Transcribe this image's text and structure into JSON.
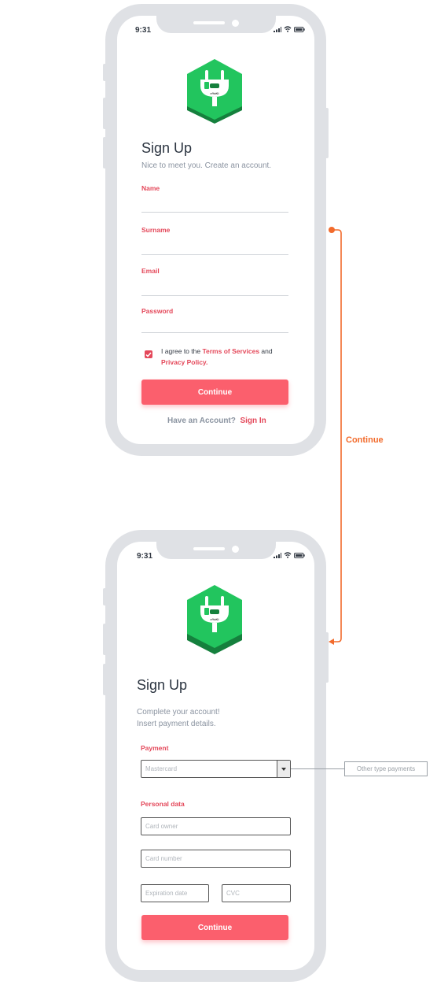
{
  "screen1": {
    "time": "9:31",
    "title": "Sign Up",
    "subtitle": "Nice to meet you. Create an account.",
    "fields": [
      {
        "label": "Name"
      },
      {
        "label": "Surname"
      },
      {
        "label": "Email"
      },
      {
        "label": "Password"
      }
    ],
    "agree_prefix": "I agree to the ",
    "terms_link": "Terms of Services",
    "agree_and": " and",
    "privacy_link": "Privacy Policy.",
    "continue_label": "Continue",
    "have_account": "Have an Account?",
    "sign_in": "Sign In"
  },
  "flow": {
    "label": "Continue",
    "color": "#f26b2c"
  },
  "screen2": {
    "time": "9:31",
    "title": "Sign Up",
    "subtitle_line1": "Complete your account!",
    "subtitle_line2": "Insert payment details.",
    "payment_label": "Payment",
    "payment_select": "Mastercard",
    "personal_label": "Personal data",
    "card_owner_placeholder": "Card owner",
    "card_number_placeholder": "Card number",
    "expiration_placeholder": "Expiration date",
    "cvc_placeholder": "CVC",
    "continue_label": "Continue"
  },
  "annotation": {
    "other_payments": "Other type payments"
  },
  "logo": {
    "text": "eYoKi",
    "color_top": "#22c55e",
    "color_bottom": "#15803d"
  },
  "colors": {
    "accent": "#e4485a",
    "button": "#fb5f6d",
    "frame": "#dfe1e5"
  }
}
